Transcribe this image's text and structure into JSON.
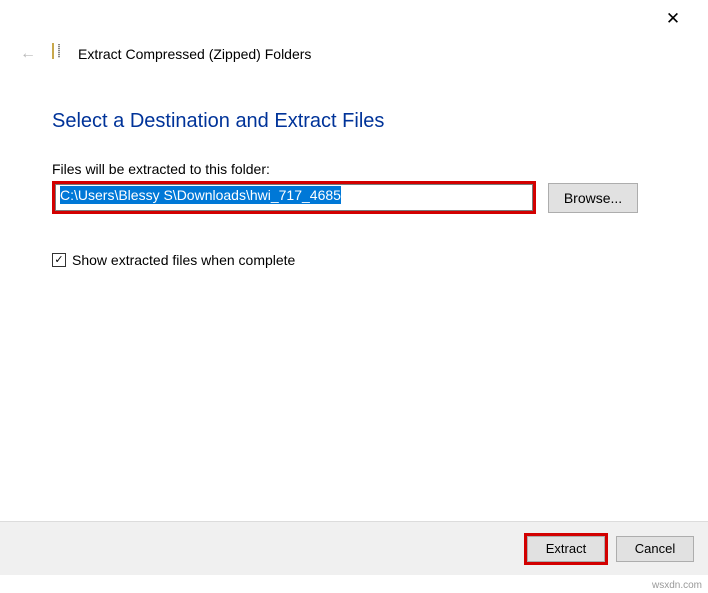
{
  "titlebar": {
    "close_glyph": "✕"
  },
  "header": {
    "back_arrow": "←",
    "title": "Extract Compressed (Zipped) Folders"
  },
  "main": {
    "heading": "Select a Destination and Extract Files",
    "field_label": "Files will be extracted to this folder:",
    "path_value": "C:\\Users\\Blessy S\\Downloads\\hwi_717_4685",
    "browse_label": "Browse...",
    "checkbox_checked_glyph": "✓",
    "checkbox_label": "Show extracted files when complete"
  },
  "footer": {
    "extract_label": "Extract",
    "cancel_label": "Cancel"
  },
  "watermark": "wsxdn.com"
}
